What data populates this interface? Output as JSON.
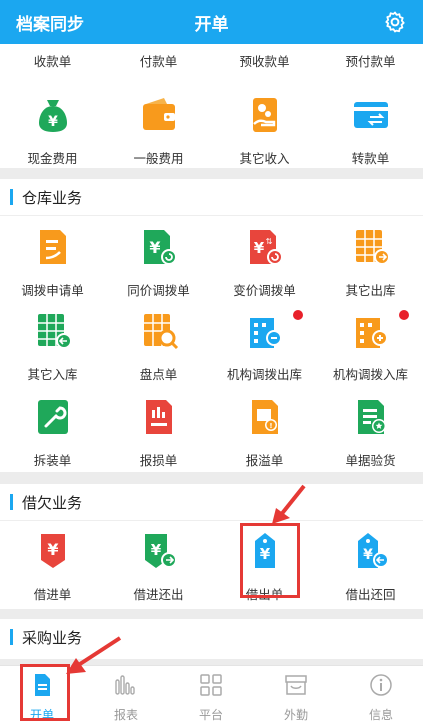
{
  "header": {
    "left": "档案同步",
    "title": "开单",
    "settings_icon": "gear-icon"
  },
  "top_row": [
    "收款单",
    "付款单",
    "预收款单",
    "预付款单"
  ],
  "finance": [
    {
      "label": "现金费用",
      "icon": "money-bag-icon"
    },
    {
      "label": "一般费用",
      "icon": "wallet-icon"
    },
    {
      "label": "其它收入",
      "icon": "hand-coins-icon"
    },
    {
      "label": "转款单",
      "icon": "transfer-card-icon"
    }
  ],
  "warehouse": {
    "title": "仓库业务",
    "items": [
      {
        "label": "调拨申请单",
        "icon": "transfer-request-icon"
      },
      {
        "label": "同价调拨单",
        "icon": "same-price-transfer-icon"
      },
      {
        "label": "变价调拨单",
        "icon": "changed-price-transfer-icon"
      },
      {
        "label": "其它出库",
        "icon": "stock-out-icon"
      },
      {
        "label": "其它入库",
        "icon": "stock-in-icon"
      },
      {
        "label": "盘点单",
        "icon": "inventory-check-icon"
      },
      {
        "label": "机构调拨出库",
        "icon": "org-transfer-out-icon"
      },
      {
        "label": "机构调拨入库",
        "icon": "org-transfer-in-icon"
      },
      {
        "label": "拆装单",
        "icon": "assembly-icon"
      },
      {
        "label": "报损单",
        "icon": "loss-report-icon"
      },
      {
        "label": "报溢单",
        "icon": "overflow-report-icon"
      },
      {
        "label": "单据验货",
        "icon": "document-check-icon"
      }
    ]
  },
  "debt": {
    "title": "借欠业务",
    "items": [
      {
        "label": "借进单",
        "icon": "borrow-in-icon"
      },
      {
        "label": "借进还出",
        "icon": "borrow-in-return-icon"
      },
      {
        "label": "借出单",
        "icon": "lend-out-icon"
      },
      {
        "label": "借出还回",
        "icon": "lend-out-return-icon"
      }
    ]
  },
  "purchase": {
    "title": "采购业务"
  },
  "tabs": [
    {
      "label": "开单",
      "icon": "document-icon"
    },
    {
      "label": "报表",
      "icon": "bar-chart-icon"
    },
    {
      "label": "平台",
      "icon": "grid-icon"
    },
    {
      "label": "外勤",
      "icon": "store-icon"
    },
    {
      "label": "信息",
      "icon": "info-icon"
    }
  ],
  "colors": {
    "accent": "#1ba7f0",
    "green": "#1fa85a",
    "orange": "#f89a1c",
    "red": "#e8453c",
    "highlight": "#e53935"
  }
}
